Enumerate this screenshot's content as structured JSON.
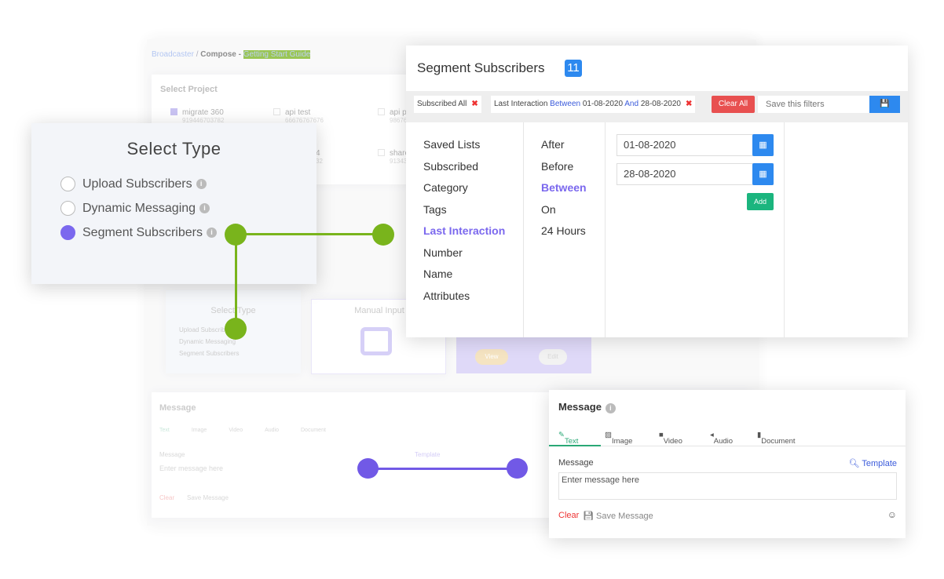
{
  "background_app": {
    "breadcrumb": {
      "root": "Broadcaster",
      "separator": "/",
      "current": "Compose -",
      "guide_link": "Getting Start Guide"
    },
    "select_project": {
      "title": "Select Project",
      "projects": [
        {
          "name": "migrate 360",
          "number": "919446703782",
          "checked": true
        },
        {
          "name": "api test",
          "number": "66676767676",
          "checked": false
        },
        {
          "name": "api pr",
          "number": "98676",
          "checked": false
        },
        {
          "name": "4",
          "number": "32",
          "checked": false
        },
        {
          "name": "share",
          "number": "91343",
          "checked": false
        }
      ]
    },
    "select_type": {
      "title": "Select Type",
      "options": [
        "Upload Subscribers",
        "Dynamic Messaging",
        "Segment Subscribers"
      ]
    },
    "manual_input": {
      "title": "Manual Input"
    },
    "preview": {
      "view": "View",
      "edit": "Edit"
    },
    "message": {
      "title": "Message",
      "tabs": [
        "Text",
        "Image",
        "Video",
        "Audio",
        "Document"
      ],
      "label": "Message",
      "placeholder": "Enter message here",
      "template": "Template",
      "clear": "Clear",
      "save": "Save Message"
    }
  },
  "select_type_popup": {
    "title": "Select Type",
    "options": [
      {
        "label": "Upload Subscribers",
        "selected": false
      },
      {
        "label": "Dynamic Messaging",
        "selected": false
      },
      {
        "label": "Segment Subscribers",
        "selected": true
      }
    ]
  },
  "segment": {
    "title": "Segment Subscribers",
    "count": "11",
    "filters": {
      "chip1": "Subscribed All",
      "chip2_prefix": "Last Interaction",
      "chip2_op": "Between",
      "chip2_from": "01-08-2020",
      "chip2_and": "And",
      "chip2_to": "28-08-2020",
      "clear_all": "Clear All",
      "save_placeholder": "Save this filters"
    },
    "categories": [
      "Saved Lists",
      "Subscribed",
      "Category",
      "Tags",
      "Last Interaction",
      "Number",
      "Name",
      "Attributes"
    ],
    "active_category": "Last Interaction",
    "operators": [
      "After",
      "Before",
      "Between",
      "On",
      "24 Hours"
    ],
    "active_operator": "Between",
    "date_from": "01-08-2020",
    "date_to": "28-08-2020",
    "add": "Add"
  },
  "message": {
    "title": "Message",
    "tabs": [
      "Text",
      "Image",
      "Video",
      "Audio",
      "Document"
    ],
    "active_tab": "Text",
    "label": "Message",
    "template": "Template",
    "placeholder": "Enter message here",
    "clear": "Clear",
    "save": "Save Message"
  },
  "colors": {
    "accent_purple": "#7b68ee",
    "connector_green": "#79b41c",
    "connector_purple": "#7159e6",
    "primary_blue": "#2d89ef",
    "danger": "#e85050",
    "success": "#1bb57e"
  }
}
